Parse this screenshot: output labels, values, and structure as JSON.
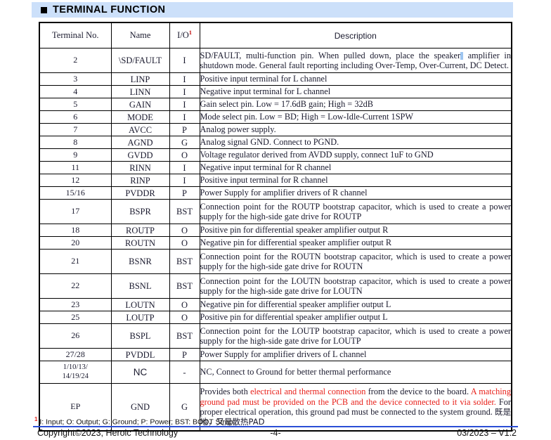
{
  "section": {
    "bullet": "black-square-bullet",
    "title": "TERMINAL FUNCTION",
    "banner_color": "#cce0fa"
  },
  "table": {
    "headers": {
      "terminal": "Terminal No.",
      "name": "Name",
      "io": "I/O",
      "io_superscript": "1",
      "description": "Description"
    },
    "rows": [
      {
        "terminal": "2",
        "name": "\\SD/FAULT",
        "io": "I",
        "desc_pre": "SD/FAULT, multi-function pin. When pulled down, place the speaker",
        "desc_post": "amplifier in shutdown mode. General fault reporting including Over-Temp, Over-Current, DC Detect.",
        "lines": 2,
        "has_caret": true
      },
      {
        "terminal": "3",
        "name": "LINP",
        "io": "I",
        "desc": "Positive input terminal for L channel",
        "lines": 1
      },
      {
        "terminal": "4",
        "name": "LINN",
        "io": "I",
        "desc": "Negative input terminal for L channel",
        "lines": 1
      },
      {
        "terminal": "5",
        "name": "GAIN",
        "io": "I",
        "desc": "Gain select pin. Low = 17.6dB gain; High = 32dB",
        "lines": 1
      },
      {
        "terminal": "6",
        "name": "MODE",
        "io": "I",
        "desc": "Mode select pin. Low = BD; High = Low-Idle-Current 1SPW",
        "lines": 1
      },
      {
        "terminal": "7",
        "name": "AVCC",
        "io": "P",
        "desc": "Analog power supply.",
        "lines": 1
      },
      {
        "terminal": "8",
        "name": "AGND",
        "io": "G",
        "desc": "Analog signal GND. Connect to PGND.",
        "lines": 1
      },
      {
        "terminal": "9",
        "name": "GVDD",
        "io": "O",
        "desc": "Voltage regulator derived from AVDD supply, connect 1uF to GND",
        "lines": 1
      },
      {
        "terminal": "11",
        "name": "RINN",
        "io": "I",
        "desc": "Negative input terminal for R channel",
        "lines": 1
      },
      {
        "terminal": "12",
        "name": "RINP",
        "io": "I",
        "desc": "Positive input terminal for R channel",
        "lines": 1
      },
      {
        "terminal": "15/16",
        "name": "PVDDR",
        "io": "P",
        "desc": "Power Supply for amplifier drivers of R channel",
        "lines": 1
      },
      {
        "terminal": "17",
        "name": "BSPR",
        "io": "BST",
        "desc": "Connection point for the ROUTP bootstrap capacitor, which is used to create a power supply for the high-side gate drive for ROUTP",
        "lines": 2
      },
      {
        "terminal": "18",
        "name": "ROUTP",
        "io": "O",
        "desc": "Positive pin for differential speaker amplifier output R",
        "lines": 1
      },
      {
        "terminal": "20",
        "name": "ROUTN",
        "io": "O",
        "desc": "Negative pin for differential speaker amplifier output R",
        "lines": 1
      },
      {
        "terminal": "21",
        "name": "BSNR",
        "io": "BST",
        "desc": "Connection point for the ROUTN bootstrap capacitor, which is used to create a power supply for the high-side gate drive for ROUTN",
        "lines": 2
      },
      {
        "terminal": "22",
        "name": "BSNL",
        "io": "BST",
        "desc": "Connection point for the LOUTN bootstrap capacitor, which is used to create a power supply for the high-side gate drive for LOUTN",
        "lines": 2
      },
      {
        "terminal": "23",
        "name": "LOUTN",
        "io": "O",
        "desc": "Negative pin for differential speaker amplifier output L",
        "lines": 1
      },
      {
        "terminal": "25",
        "name": "LOUTP",
        "io": "O",
        "desc": "Positive pin for differential speaker amplifier output L",
        "lines": 1
      },
      {
        "terminal": "26",
        "name": "BSPL",
        "io": "BST",
        "desc": "Connection point for the LOUTP bootstrap capacitor, which is used to create a power supply for the high-side gate drive for LOUTP",
        "lines": 2
      },
      {
        "terminal": "27/28",
        "name": "PVDDL",
        "io": "P",
        "desc": "Power Supply for amplifier drivers of L channel",
        "lines": 1
      }
    ],
    "nc_row": {
      "terminal_line1": "1/10/13/",
      "terminal_line2": "14/19/24",
      "name": "NC",
      "io": "-",
      "desc": "NC, Connect to Ground for better thermal performance"
    },
    "ep_row": {
      "terminal": "EP",
      "name": "GND",
      "io": "G",
      "desc_seg1": "Provides both ",
      "desc_seg2_red": "electrical and thermal connection",
      "desc_seg3": " from the device to the board. ",
      "desc_seg4_red": "A matching ground pad must be provided on the PCB and the device connected to it via solder.",
      "desc_seg5": " For proper electrical operation, this ground pad must be connected to the system ground. ",
      "desc_seg6_cjk": "既是地，又是散热PAD",
      "red_color": "#e8201a"
    }
  },
  "footnote": {
    "mark": "1",
    "text": "I: Input; O: Output; G: Ground; P: Power; BST: BOOT Strap;"
  },
  "footer": {
    "copyright": "Copyright©2023, Heroic Technology",
    "page": "-4-",
    "version": "03/2023 – V1.2",
    "rule_color": "#2b4ed6"
  }
}
